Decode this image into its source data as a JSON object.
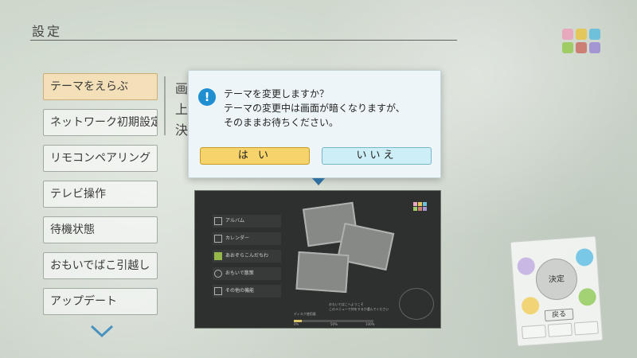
{
  "header": {
    "title": "設定"
  },
  "colors": {
    "logo": [
      "#e6a2b9",
      "#e2c34e",
      "#62bbd8",
      "#98c85a",
      "#c8756a",
      "#9c8ed0"
    ],
    "selected_menu": "#f2ddb2",
    "dialog_yes": "#f6d36b",
    "dialog_no": "#cdeef6",
    "alert_icon": "#1f8fd2"
  },
  "menu": {
    "items": [
      {
        "label": "テーマをえらぶ",
        "selected": true
      },
      {
        "label": "ネットワーク初期設定",
        "selected": false
      },
      {
        "label": "リモコンペアリング",
        "selected": false
      },
      {
        "label": "テレビ操作",
        "selected": false
      },
      {
        "label": "待機状態",
        "selected": false
      },
      {
        "label": "おもいでばこ引越し",
        "selected": false
      },
      {
        "label": "アップデート",
        "selected": false
      }
    ],
    "scroll_icon": "chevron-down-icon"
  },
  "description": {
    "lines": [
      "画",
      "上",
      "決"
    ]
  },
  "preview": {
    "menu": [
      "アルバム",
      "カレンダー",
      "あおぞらこんだちわ",
      "おもいで散策",
      "その他の機能"
    ],
    "bar_labels": [
      "ディスク使用量",
      "0%",
      "50%",
      "100%"
    ],
    "bar_fill": 0.1,
    "side_text": [
      "おもいでばこへようこそ",
      "このメニューで何をするか選んでください"
    ]
  },
  "remote": {
    "center_label": "決定",
    "back_label": "戻る"
  },
  "dialog": {
    "icon": "exclamation-icon",
    "lines": [
      "テーマを変更しますか？",
      "テーマの変更中は画面が暗くなりますが、",
      "そのままお待ちください。"
    ],
    "yes_label": "は い",
    "no_label": "いいえ"
  }
}
